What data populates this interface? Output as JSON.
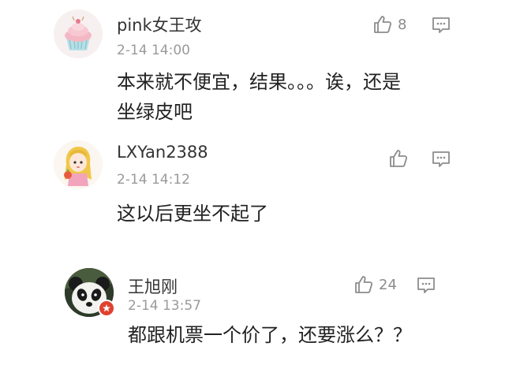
{
  "comments": [
    {
      "username": "pink女王攻",
      "time": "2-14 14:00",
      "like_count": "8",
      "content_lines": [
        "本来就不便宜，结果。。。诶，还是",
        "坐绿皮吧"
      ]
    },
    {
      "username": "LXYan2388",
      "time": "2-14 14:12",
      "like_count": "",
      "content_lines": [
        "这以后更坐不起了"
      ]
    },
    {
      "username": "王旭刚",
      "time": "2-14 13:57",
      "like_count": "24",
      "content_lines": [
        "都跟机票一个价了，还要涨么？？"
      ]
    }
  ],
  "icons": {
    "like": "thumbs-up-icon",
    "reply": "comment-icon",
    "badge": "verified-badge-icon"
  },
  "colors": {
    "badge": "#e0412f",
    "meta": "#9a9a9a",
    "icon": "#8c8c8c"
  }
}
